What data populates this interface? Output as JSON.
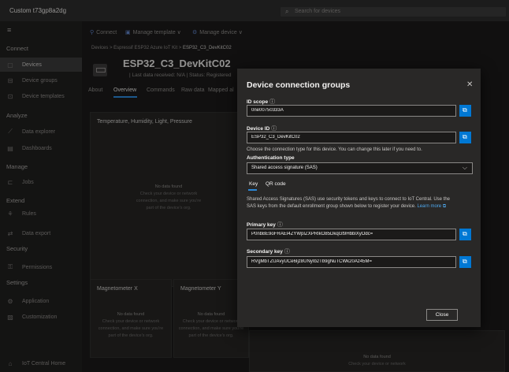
{
  "app": {
    "title": "Custom t73gp8a2dg"
  },
  "search": {
    "placeholder": "Search for devices"
  },
  "sidebar": {
    "sections": {
      "connect": "Connect",
      "analyze": "Analyze",
      "manage": "Manage",
      "extend": "Extend",
      "security": "Security",
      "settings": "Settings"
    },
    "items": [
      {
        "label": "Devices",
        "icon": "devices-icon"
      },
      {
        "label": "Device groups",
        "icon": "device-groups-icon"
      },
      {
        "label": "Device templates",
        "icon": "device-templates-icon"
      },
      {
        "label": "Data explorer",
        "icon": "chart-icon"
      },
      {
        "label": "Dashboards",
        "icon": "dashboard-icon"
      },
      {
        "label": "Jobs",
        "icon": "jobs-icon"
      },
      {
        "label": "Rules",
        "icon": "rules-icon"
      },
      {
        "label": "Data export",
        "icon": "export-icon"
      },
      {
        "label": "Permissions",
        "icon": "permissions-icon"
      },
      {
        "label": "Application",
        "icon": "application-icon"
      },
      {
        "label": "Customization",
        "icon": "customization-icon"
      }
    ],
    "footer": "IoT Central Home"
  },
  "breadcrumb": {
    "prefix": "Devices > Espressif ESP32 Azure IoT Kit > ",
    "current": "ESP32_C3_DevKitC02"
  },
  "commands": {
    "connect": "Connect",
    "manage_template": "Manage template ∨",
    "manage_device": "Manage device ∨"
  },
  "device": {
    "name": "ESP32_C3_DevKitC02",
    "status": "| Last data received: N/A | Status: Registered"
  },
  "tabs": [
    "About",
    "Overview",
    "Commands",
    "Raw data",
    "Mapped al"
  ],
  "cards": {
    "temp_title": "Temperature, Humidity, Light, Pressure",
    "mag_x": "Magnetometer X",
    "mag_y": "Magnetometer Y",
    "no_data": "No data found",
    "check_l1": "Check your device or network",
    "check_l2": "connection, and make sure you're",
    "check_l3": "part of the device's org."
  },
  "dialog": {
    "title": "Device connection groups",
    "id_scope_label": "ID scope",
    "id_scope_value": "0ne00750333A",
    "device_id_label": "Device ID",
    "device_id_value": "ESP32_C3_DevKitC02",
    "choose_text": "Choose the connection type for this device. You can change this later if you need to.",
    "auth_label": "Authentication type",
    "auth_value": "Shared access signature (SAS)",
    "tab_key": "Key",
    "tab_qr": "QR code",
    "sas_line1": "Shared Access Signatures (SAS) use security tokens and keys to connect to IoT Central. Use the",
    "sas_line2": "SAS keys from the default enrollment group shown below to register your device.",
    "learn_more": "Learn more",
    "primary_label": "Primary key",
    "primary_value": "P0nbBE9oFRAEI4ZYWpIZXPRIkO85DkqGt9HbblXyOdc=",
    "secondary_label": "Secondary key",
    "secondary_value": "RVgMbTZUAvyUCe6Ijz8UNyIb2Tb9gNuTCWk20Az45M=",
    "close": "Close"
  },
  "colors": {
    "accent": "#0078d4",
    "link": "#4fa9ef",
    "dialog_bg": "#292827"
  }
}
